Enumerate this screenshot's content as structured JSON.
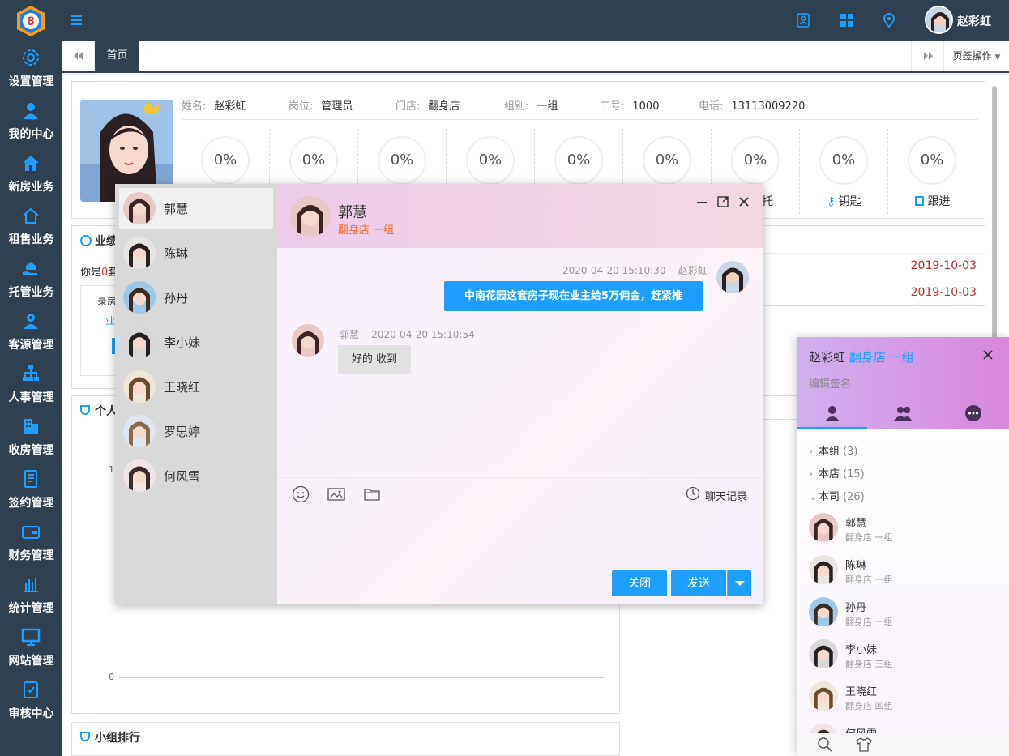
{
  "topbar": {
    "logo_text": "8",
    "user_name": "赵彩虹",
    "icons": [
      "contacts-icon",
      "grid-icon",
      "location-icon"
    ]
  },
  "sidebar": {
    "items": [
      {
        "label": "设置管理",
        "icon": "gear-icon"
      },
      {
        "label": "我的中心",
        "icon": "user-icon"
      },
      {
        "label": "新房业务",
        "icon": "house-icon"
      },
      {
        "label": "租售业务",
        "icon": "home-outline-icon"
      },
      {
        "label": "托管业务",
        "icon": "hand-house-icon"
      },
      {
        "label": "客源管理",
        "icon": "customers-icon"
      },
      {
        "label": "人事管理",
        "icon": "org-chart-icon"
      },
      {
        "label": "收房管理",
        "icon": "building-icon"
      },
      {
        "label": "签约管理",
        "icon": "contract-icon"
      },
      {
        "label": "财务管理",
        "icon": "wallet-icon"
      },
      {
        "label": "统计管理",
        "icon": "bar-chart-icon"
      },
      {
        "label": "网站管理",
        "icon": "monitor-icon"
      },
      {
        "label": "审核中心",
        "icon": "check-clipboard-icon"
      }
    ]
  },
  "tabs": {
    "home": "首页",
    "ops": "页签操作"
  },
  "profile": {
    "fields": [
      {
        "key": "姓名:",
        "value": "赵彩虹"
      },
      {
        "key": "岗位:",
        "value": "管理员"
      },
      {
        "key": "门店:",
        "value": "翻身店"
      },
      {
        "key": "组别:",
        "value": "一组"
      },
      {
        "key": "工号:",
        "value": "1000"
      },
      {
        "key": "电话:",
        "value": "13113009220"
      }
    ],
    "stats": [
      {
        "value": "0%",
        "label": ""
      },
      {
        "value": "0%",
        "label": ""
      },
      {
        "value": "0%",
        "label": ""
      },
      {
        "value": "0%",
        "label": ""
      },
      {
        "value": "0%",
        "label": ""
      },
      {
        "value": "0%",
        "label": ""
      },
      {
        "value": "0%",
        "label": "托"
      },
      {
        "value": "0%",
        "label": "钥匙"
      },
      {
        "value": "0%",
        "label": "跟进"
      }
    ]
  },
  "panels": {
    "perf_title": "业绩",
    "perf_text_prefix": "你是",
    "perf_count": "0",
    "perf_text_suffix": "套",
    "perf_box_1": "录房",
    "perf_box_2": "业",
    "personal_title": "个人",
    "chart_y_top": "1",
    "chart_y_zero": "0",
    "group_title": "小组排行",
    "dates": [
      "2019-10-03",
      "2019-10-03"
    ]
  },
  "chat": {
    "contacts": [
      "郭慧",
      "陈琳",
      "孙丹",
      "李小妹",
      "王晓红",
      "罗思婷",
      "何风雪"
    ],
    "active_name": "郭慧",
    "active_sub": "翻身店 一组",
    "messages": [
      {
        "time": "2020-04-20 15:10:30",
        "sender": "赵彩虹",
        "text": "中南花园这套房子现在业主给5万佣金，赶紧推"
      },
      {
        "time": "2020-04-20 15:10:54",
        "sender": "郭慧",
        "text": "好的 收到"
      }
    ],
    "history_label": "聊天记录",
    "close_label": "关闭",
    "send_label": "发送"
  },
  "contact_panel": {
    "name": "赵彩虹",
    "store": "翻身店 一组",
    "sign": "编辑签名",
    "groups": [
      {
        "name": "本组",
        "count": "(3)"
      },
      {
        "name": "本店",
        "count": "(15)"
      },
      {
        "name": "本司",
        "count": "(26)"
      }
    ],
    "members": [
      {
        "name": "郭慧",
        "sub": "翻身店 一组"
      },
      {
        "name": "陈琳",
        "sub": "翻身店 一组"
      },
      {
        "name": "孙丹",
        "sub": "翻身店 一组"
      },
      {
        "name": "李小妹",
        "sub": "翻身店 三组"
      },
      {
        "name": "王晓红",
        "sub": "翻身店 四组"
      },
      {
        "name": "何风雪",
        "sub": ""
      }
    ]
  },
  "colors": {
    "nav_bg": "#2f4050",
    "accent": "#1e9fff",
    "date_red": "#b73131",
    "sub_orange": "#f56c2a"
  }
}
